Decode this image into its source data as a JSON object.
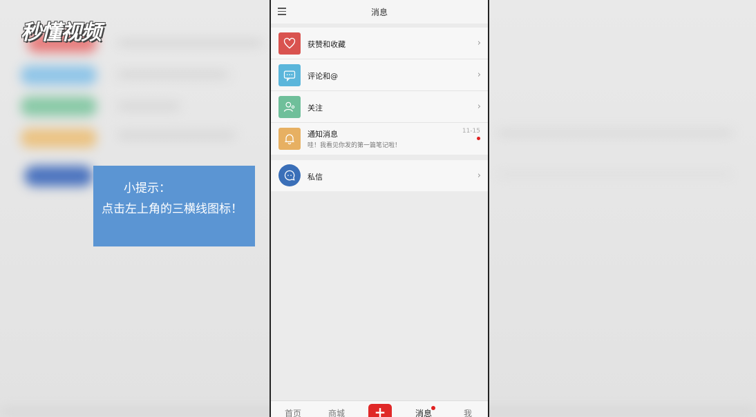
{
  "watermark": {
    "text": "秒懂视频"
  },
  "tip": {
    "line1": "小提示：",
    "line2": "点击左上角的三横线图标！"
  },
  "header": {
    "title": "消息",
    "menu_icon": "hamburger-icon"
  },
  "items": [
    {
      "label": "获赞和收藏",
      "icon": "heart-icon",
      "color": "#d9534f"
    },
    {
      "label": "评论和@",
      "icon": "comment-icon",
      "color": "#5bb6db"
    },
    {
      "label": "关注",
      "icon": "user-icon",
      "color": "#6fbf9a"
    },
    {
      "label": "通知消息",
      "sub": "哇！我看见你发的第一篇笔记啦！",
      "date": "11-15",
      "icon": "bell-icon",
      "color": "#e7b062"
    }
  ],
  "private": {
    "label": "私信",
    "icon": "chat-icon",
    "color": "#3a6fb8"
  },
  "tabs": {
    "home": "首页",
    "mall": "商城",
    "add": "+",
    "messages": "消息",
    "me": "我"
  }
}
